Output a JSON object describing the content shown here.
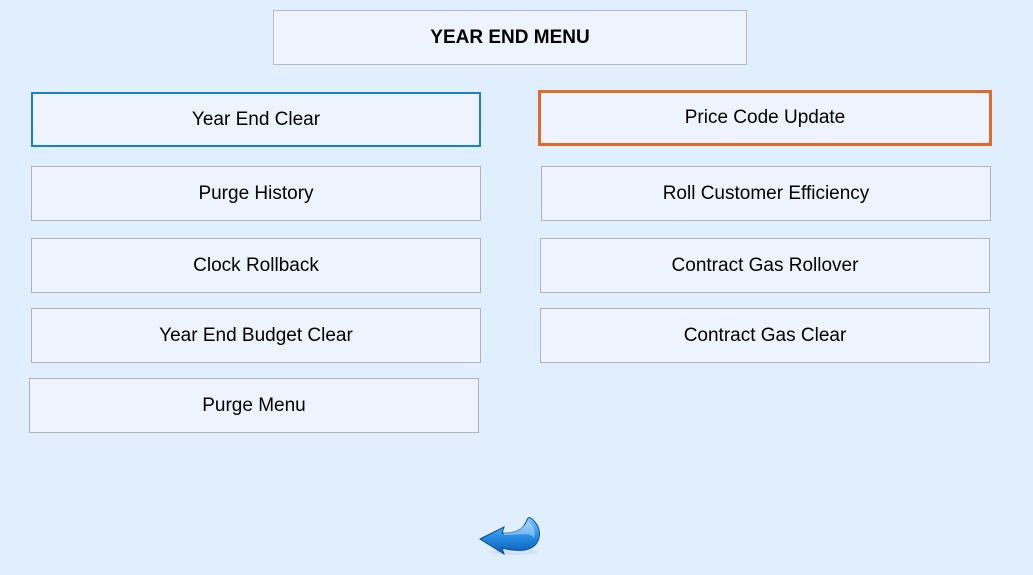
{
  "title": "YEAR END MENU",
  "colors": {
    "background": "#e1eefd",
    "focus_border": "#1a7fc4",
    "selected_border": "#e06a2c"
  },
  "buttons": {
    "year_end_clear": "Year End Clear",
    "purge_history": "Purge History",
    "clock_rollback": "Clock Rollback",
    "year_end_budget_clear": "Year End Budget Clear",
    "purge_menu": "Purge Menu",
    "price_code_update": "Price Code Update",
    "roll_customer_efficiency": "Roll Customer Efficiency",
    "contract_gas_rollover": "Contract Gas Rollover",
    "contract_gas_clear": "Contract Gas Clear"
  },
  "back_icon": "back-arrow-icon"
}
